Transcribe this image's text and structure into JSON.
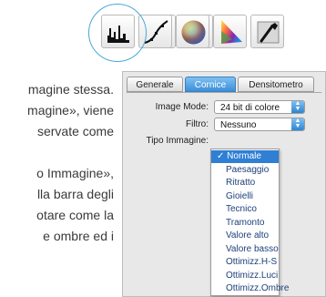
{
  "toolbar": {
    "tools": [
      {
        "icon": "zoom-icon"
      },
      {
        "icon": "color-wheel-icon"
      },
      {
        "icon": "histogram-icon"
      },
      {
        "icon": "curve-icon"
      },
      {
        "icon": "color-sphere-icon"
      },
      {
        "icon": "triangle-gamut-icon"
      },
      {
        "icon": "eyedropper-icon"
      }
    ],
    "highlight_color": "#4aa8d8"
  },
  "body_text": {
    "lines": [
      "magine stessa.",
      "magine», viene",
      "servate come",
      "",
      "o Immagine»,",
      "lla barra degli",
      "otare come la",
      "e ombre ed i"
    ]
  },
  "dialog": {
    "tabs": [
      {
        "label": "Generale",
        "active": false
      },
      {
        "label": "Cornice",
        "active": true
      },
      {
        "label": "Densitometro",
        "active": false
      }
    ],
    "fields": {
      "image_mode": {
        "label": "Image Mode:",
        "value": "24 bit di colore"
      },
      "filtro": {
        "label": "Filtro:",
        "value": "Nessuno"
      },
      "tipo_immagine": {
        "label": "Tipo Immagine:"
      }
    },
    "menu": {
      "selected_mark": "✓",
      "items": [
        {
          "label": "Normale",
          "selected": true
        },
        {
          "label": "Paesaggio",
          "selected": false
        },
        {
          "label": "Ritratto",
          "selected": false
        },
        {
          "label": "Gioielli",
          "selected": false
        },
        {
          "label": "Tecnico",
          "selected": false
        },
        {
          "label": "Tramonto",
          "selected": false
        },
        {
          "label": "Valore alto",
          "selected": false
        },
        {
          "label": "Valore basso",
          "selected": false
        },
        {
          "label": "Ottimizz.H-S",
          "selected": false
        },
        {
          "label": "Ottimizz.Luci",
          "selected": false
        },
        {
          "label": "Ottimizz.Ombre",
          "selected": false
        }
      ]
    },
    "accent_color": "#2f7fd4"
  }
}
